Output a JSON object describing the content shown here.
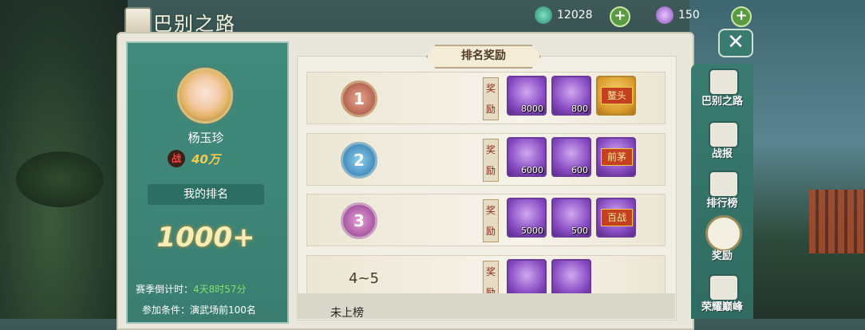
{
  "header": {
    "title": "巴别之路",
    "jade_amount": "12028",
    "gem_amount": "150",
    "plus_label": "+"
  },
  "profile": {
    "name": "杨玉珍",
    "power_badge": "战",
    "power_value": "40万",
    "my_rank_label": "我的排名",
    "my_rank_value": "1000+",
    "season_label": "赛季倒计时：",
    "season_value": "4天8时57分",
    "condition": "参加条件：演武场前100名"
  },
  "ranking": {
    "header": "排名奖励",
    "reward_tag": "奖励",
    "rows": [
      {
        "rank": "1",
        "items": [
          {
            "count": "8000"
          },
          {
            "count": "800"
          }
        ],
        "title_label": "鳌头"
      },
      {
        "rank": "2",
        "items": [
          {
            "count": "6000"
          },
          {
            "count": "600"
          }
        ],
        "title_label": "前茅"
      },
      {
        "rank": "3",
        "items": [
          {
            "count": "5000"
          },
          {
            "count": "500"
          }
        ],
        "title_label": "百战"
      },
      {
        "rank": "4~5",
        "items": [
          {
            "count": ""
          },
          {
            "count": ""
          }
        ],
        "title_label": ""
      }
    ],
    "unranked": "未上榜"
  },
  "sidenav": {
    "items": [
      {
        "label": "巴别之路"
      },
      {
        "label": "战报"
      },
      {
        "label": "排行榜"
      },
      {
        "label": "奖励"
      },
      {
        "label": "荣耀巅峰"
      }
    ]
  },
  "colors": {
    "teal_panel": "#3f8a7c",
    "gold_rank": "#f6eeb6",
    "item_purple": "#8a4ec4"
  }
}
